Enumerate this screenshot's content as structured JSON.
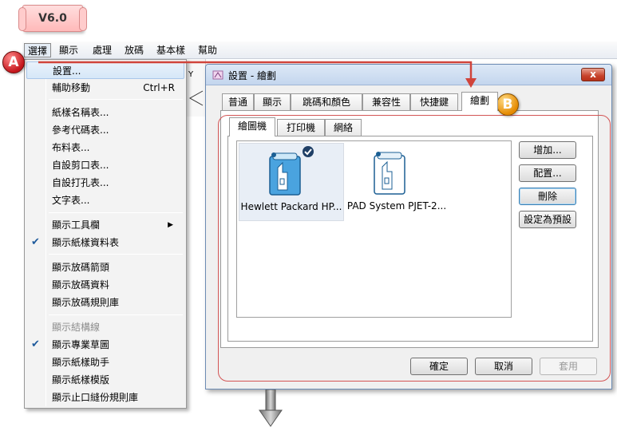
{
  "version_tag": "V6.0",
  "menubar": {
    "items": [
      "選擇",
      "顯示",
      "處理",
      "放碼",
      "基本樣",
      "幫助"
    ]
  },
  "callouts": {
    "a": "A",
    "b": "B"
  },
  "menu": {
    "items": [
      {
        "label": "設置...",
        "shortcut": ""
      },
      {
        "label": "輔助移動",
        "shortcut": "Ctrl+R"
      },
      {
        "label": "紙樣名稱表..."
      },
      {
        "label": "參考代碼表..."
      },
      {
        "label": "布料表..."
      },
      {
        "label": "自設剪口表..."
      },
      {
        "label": "自設打孔表..."
      },
      {
        "label": "文字表..."
      },
      {
        "label": "顯示工具欄"
      },
      {
        "label": "顯示紙樣資料表"
      },
      {
        "label": "顯示放碼箭頭"
      },
      {
        "label": "顯示放碼資料"
      },
      {
        "label": "顯示放碼規則庫"
      },
      {
        "label": "顯示結構線"
      },
      {
        "label": "顯示專業草圖"
      },
      {
        "label": "顯示紙樣助手"
      },
      {
        "label": "顯示紙樣模版"
      },
      {
        "label": "顯示止口縫份規則庫"
      }
    ]
  },
  "background_label": "Y",
  "dialog": {
    "title": "設置 - 繪劃",
    "close_label": "x",
    "tabs": [
      "普通",
      "顯示",
      "跳碼和顏色",
      "兼容性",
      "快捷鍵",
      "繪劃"
    ],
    "subtabs": [
      "繪圖機",
      "打印機",
      "網絡"
    ],
    "devices": [
      "Hewlett Packard HP...",
      "PAD System PJET-2..."
    ],
    "side_buttons": [
      "增加...",
      "配置...",
      "刪除",
      "設定為預設"
    ],
    "footer_buttons": [
      "確定",
      "取消",
      "套用"
    ]
  },
  "colors": {
    "callout_a": "#c4161c",
    "callout_b": "#e58a00",
    "frame": "#d35555",
    "arrow": "#d0443b"
  }
}
